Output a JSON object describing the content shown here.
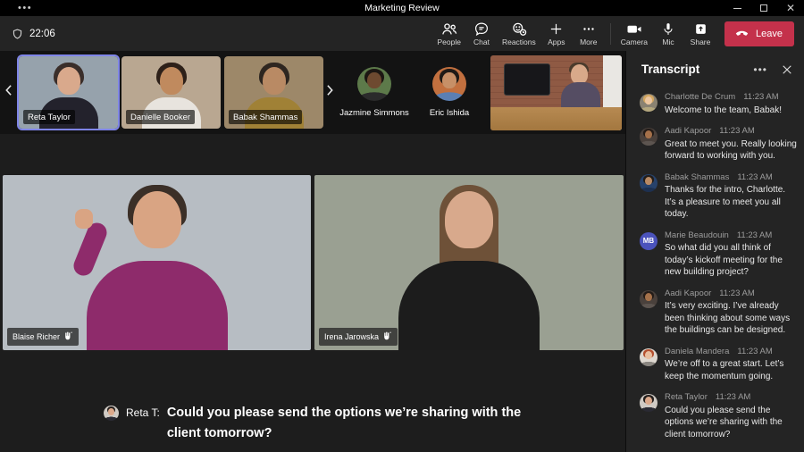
{
  "theme": {
    "accent": "#7f85e8",
    "leave_red": "#c4314b",
    "titlebar_bg": "#000000",
    "toolbar_bg": "#242424",
    "panel_bg": "#242424"
  },
  "window": {
    "title": "Marketing Review",
    "menu_icon": "more-horizontal",
    "controls": [
      "minimize",
      "maximize",
      "close"
    ]
  },
  "topbar": {
    "timer": "22:06",
    "timer_icon": "shield-icon",
    "buttons": [
      {
        "id": "people",
        "icon": "people-icon",
        "label": "People"
      },
      {
        "id": "chat",
        "icon": "chat-icon",
        "label": "Chat"
      },
      {
        "id": "reactions",
        "icon": "reactions-icon",
        "label": "Reactions"
      },
      {
        "id": "apps",
        "icon": "plus-icon",
        "label": "Apps"
      },
      {
        "id": "more",
        "icon": "more-icon",
        "label": "More"
      }
    ],
    "device_buttons": [
      {
        "id": "camera",
        "icon": "camera-icon",
        "label": "Camera"
      },
      {
        "id": "mic",
        "icon": "mic-icon",
        "label": "Mic"
      },
      {
        "id": "share",
        "icon": "share-icon",
        "label": "Share"
      }
    ],
    "leave_label": "Leave",
    "leave_icon": "phone-hangup-icon"
  },
  "filmstrip": {
    "prev_icon": "chevron-left-icon",
    "next_icon": "chevron-right-icon",
    "tiles": [
      {
        "name": "Reta Taylor",
        "selected": true,
        "colors": {
          "bg": "#96a2ac",
          "hair": "#3a2e2a",
          "skin": "#d9a98c",
          "shirt": "#23222c"
        }
      },
      {
        "name": "Danielle Booker",
        "selected": false,
        "colors": {
          "bg": "#b9a791",
          "hair": "#2d2019",
          "skin": "#c08a5e",
          "shirt": "#e8e4de"
        }
      },
      {
        "name": "Babak Shammas",
        "selected": false,
        "colors": {
          "bg": "#9d8869",
          "hair": "#2e2620",
          "skin": "#b98a64",
          "shirt": "#a08136"
        }
      }
    ],
    "avatar_tiles": [
      {
        "name": "Jazmine Simmons",
        "colors": {
          "bg": "#5d7a4a",
          "hair": "#1c1713",
          "skin": "#6e4a30",
          "shirt": "#2b2b2b"
        }
      },
      {
        "name": "Eric Ishida",
        "colors": {
          "bg": "#c2703f",
          "hair": "#1f1a16",
          "skin": "#c79067",
          "shirt": "#5b7fb3"
        }
      }
    ],
    "scene_tile": {
      "type": "video",
      "description": "office with wall tv and participant at desk"
    }
  },
  "stage": {
    "tiles": [
      {
        "name": "Blaise Richer",
        "badge_icon": "sign-language-hand-icon",
        "colors": {
          "bg": "#b7bdc3",
          "hair": "#3b2f27",
          "skin": "#d9a483",
          "shirt": "#8e2b6b"
        }
      },
      {
        "name": "Irena Jarowska",
        "badge_icon": "sign-language-hand-icon",
        "colors": {
          "bg": "#9aa092",
          "hair": "#6e5138",
          "skin": "#d8a98c",
          "shirt": "#1c1c1c"
        }
      }
    ]
  },
  "captions": {
    "speaker": "Reta T:",
    "text": "Could you please send the options we’re sharing with the client tomorrow?",
    "avatar": {
      "bg": "#cfcac4",
      "hair": "#241f1d",
      "skin": "#dca98b",
      "shirt": "#2a2a33"
    }
  },
  "transcript": {
    "title": "Transcript",
    "more_icon": "more-horizontal-icon",
    "close_icon": "close-icon",
    "messages": [
      {
        "name": "Charlotte De Crum",
        "time": "11:23 AM",
        "text": "Welcome to the team, Babak!",
        "avatar": {
          "bg": "#8a8272",
          "hair": "#d3a761",
          "skin": "#ecc6a0",
          "shirt": "#b4a77e"
        }
      },
      {
        "name": "Aadi Kapoor",
        "time": "11:23 AM",
        "text": "Great to meet you. Really looking forward to working with you.",
        "avatar": {
          "bg": "#4a413c",
          "hair": "#241c18",
          "skin": "#a5714a",
          "shirt": "#5d5550"
        }
      },
      {
        "name": "Babak Shammas",
        "time": "11:23 AM",
        "text": "Thanks for the intro, Charlotte. It’s a pleasure to meet you all today.",
        "avatar": {
          "bg": "#27426b",
          "hair": "#231d19",
          "skin": "#b98a64",
          "shirt": "#1d3050"
        }
      },
      {
        "name": "Marie Beaudouin",
        "time": "11:23 AM",
        "text": "So what did you all think of today’s kickoff meeting for the new building project?",
        "avatar": {
          "initials": "MB",
          "bg": "#4b53bc"
        }
      },
      {
        "name": "Aadi Kapoor",
        "time": "11:23 AM",
        "text": "It’s very exciting. I’ve already been thinking about some ways the buildings can be designed.",
        "avatar": {
          "bg": "#4a413c",
          "hair": "#241c18",
          "skin": "#a5714a",
          "shirt": "#5d5550"
        }
      },
      {
        "name": "Daniela Mandera",
        "time": "11:23 AM",
        "text": "We’re off to a great start. Let’s keep the momentum going.",
        "avatar": {
          "bg": "#ded8d0",
          "hair": "#b4502f",
          "skin": "#e9bfa0",
          "shirt": "#8a8680"
        }
      },
      {
        "name": "Reta Taylor",
        "time": "11:23 AM",
        "text": "Could you please send the options we’re sharing with the client tomorrow?",
        "avatar": {
          "bg": "#cfcac4",
          "hair": "#241f1d",
          "skin": "#dca98b",
          "shirt": "#2a2a33"
        }
      }
    ]
  }
}
